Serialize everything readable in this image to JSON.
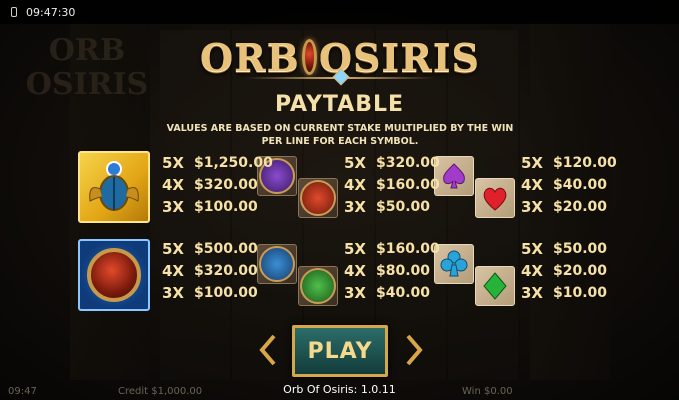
{
  "status_bar": {
    "time": "09:47:30"
  },
  "background": {
    "logo_line1": "ORB",
    "logo_line2": "OSIRIS"
  },
  "title": {
    "left": "ORB",
    "right": "OSIRIS"
  },
  "heading": "PAYTABLE",
  "subtext": "VALUES ARE BASED ON CURRENT STAKE MULTIPLIED BY THE WIN PER LINE FOR EACH SYMBOL.",
  "paytable": [
    {
      "symbol": "golden-scarab",
      "pays": [
        {
          "count": "5X",
          "amount": "$1,250.00"
        },
        {
          "count": "4X",
          "amount": "$320.00"
        },
        {
          "count": "3X",
          "amount": "$100.00"
        }
      ]
    },
    {
      "symbol": "purple-bird-and-red-jackal",
      "pays": [
        {
          "count": "5X",
          "amount": "$320.00"
        },
        {
          "count": "4X",
          "amount": "$160.00"
        },
        {
          "count": "3X",
          "amount": "$50.00"
        }
      ]
    },
    {
      "symbol": "spade-and-heart",
      "pays": [
        {
          "count": "5X",
          "amount": "$120.00"
        },
        {
          "count": "4X",
          "amount": "$40.00"
        },
        {
          "count": "3X",
          "amount": "$20.00"
        }
      ]
    },
    {
      "symbol": "blue-orb",
      "pays": [
        {
          "count": "5X",
          "amount": "$500.00"
        },
        {
          "count": "4X",
          "amount": "$320.00"
        },
        {
          "count": "3X",
          "amount": "$100.00"
        }
      ]
    },
    {
      "symbol": "blue-bird-and-green-scarab",
      "pays": [
        {
          "count": "5X",
          "amount": "$160.00"
        },
        {
          "count": "4X",
          "amount": "$80.00"
        },
        {
          "count": "3X",
          "amount": "$40.00"
        }
      ]
    },
    {
      "symbol": "club-and-diamond",
      "pays": [
        {
          "count": "5X",
          "amount": "$50.00"
        },
        {
          "count": "4X",
          "amount": "$20.00"
        },
        {
          "count": "3X",
          "amount": "$10.00"
        }
      ]
    }
  ],
  "play_label": "PLAY",
  "footer": {
    "version": "Orb Of Osiris: 1.0.11",
    "time": "09:47",
    "credit": "Credit  $1,000.00",
    "win": "Win  $0.00"
  },
  "colors": {
    "gold": "#e8c27a",
    "text": "#f6e2a6",
    "play_bg": "#2c6d6a"
  }
}
